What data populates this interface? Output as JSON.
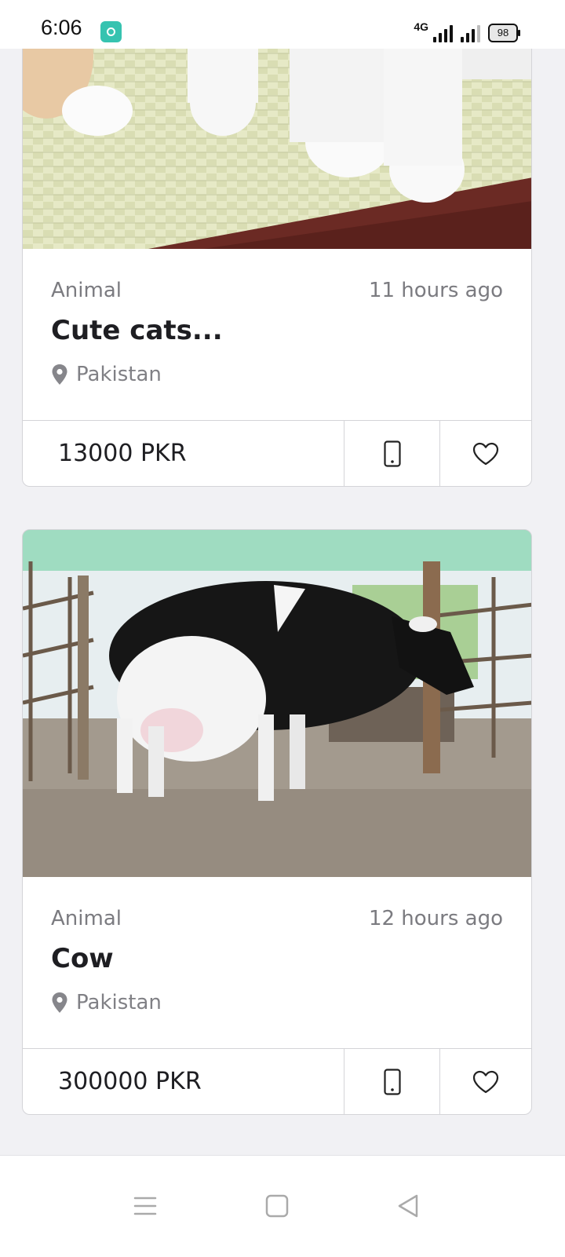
{
  "status_bar": {
    "time": "6:06",
    "network": "4G",
    "battery": "98"
  },
  "listings": [
    {
      "category": "Animal",
      "time_ago": "11 hours ago",
      "title": "Cute cats...",
      "location": "Pakistan",
      "price": "13000 PKR",
      "image": "cats-paws-on-woven-mat"
    },
    {
      "category": "Animal",
      "time_ago": "12 hours ago",
      "title": "Cow",
      "location": "Pakistan",
      "price": "300000 PKR",
      "image": "holstein-cow-in-barn"
    }
  ],
  "icons": {
    "location": "map-pin-icon",
    "call": "phone-icon",
    "favorite": "heart-icon"
  },
  "nav_bar": {
    "items": [
      "menu",
      "home",
      "back"
    ]
  },
  "colors": {
    "background": "#f1f1f4",
    "text_primary": "#1e1e22",
    "text_secondary": "#7b7b80",
    "border": "#d4d4d8"
  }
}
